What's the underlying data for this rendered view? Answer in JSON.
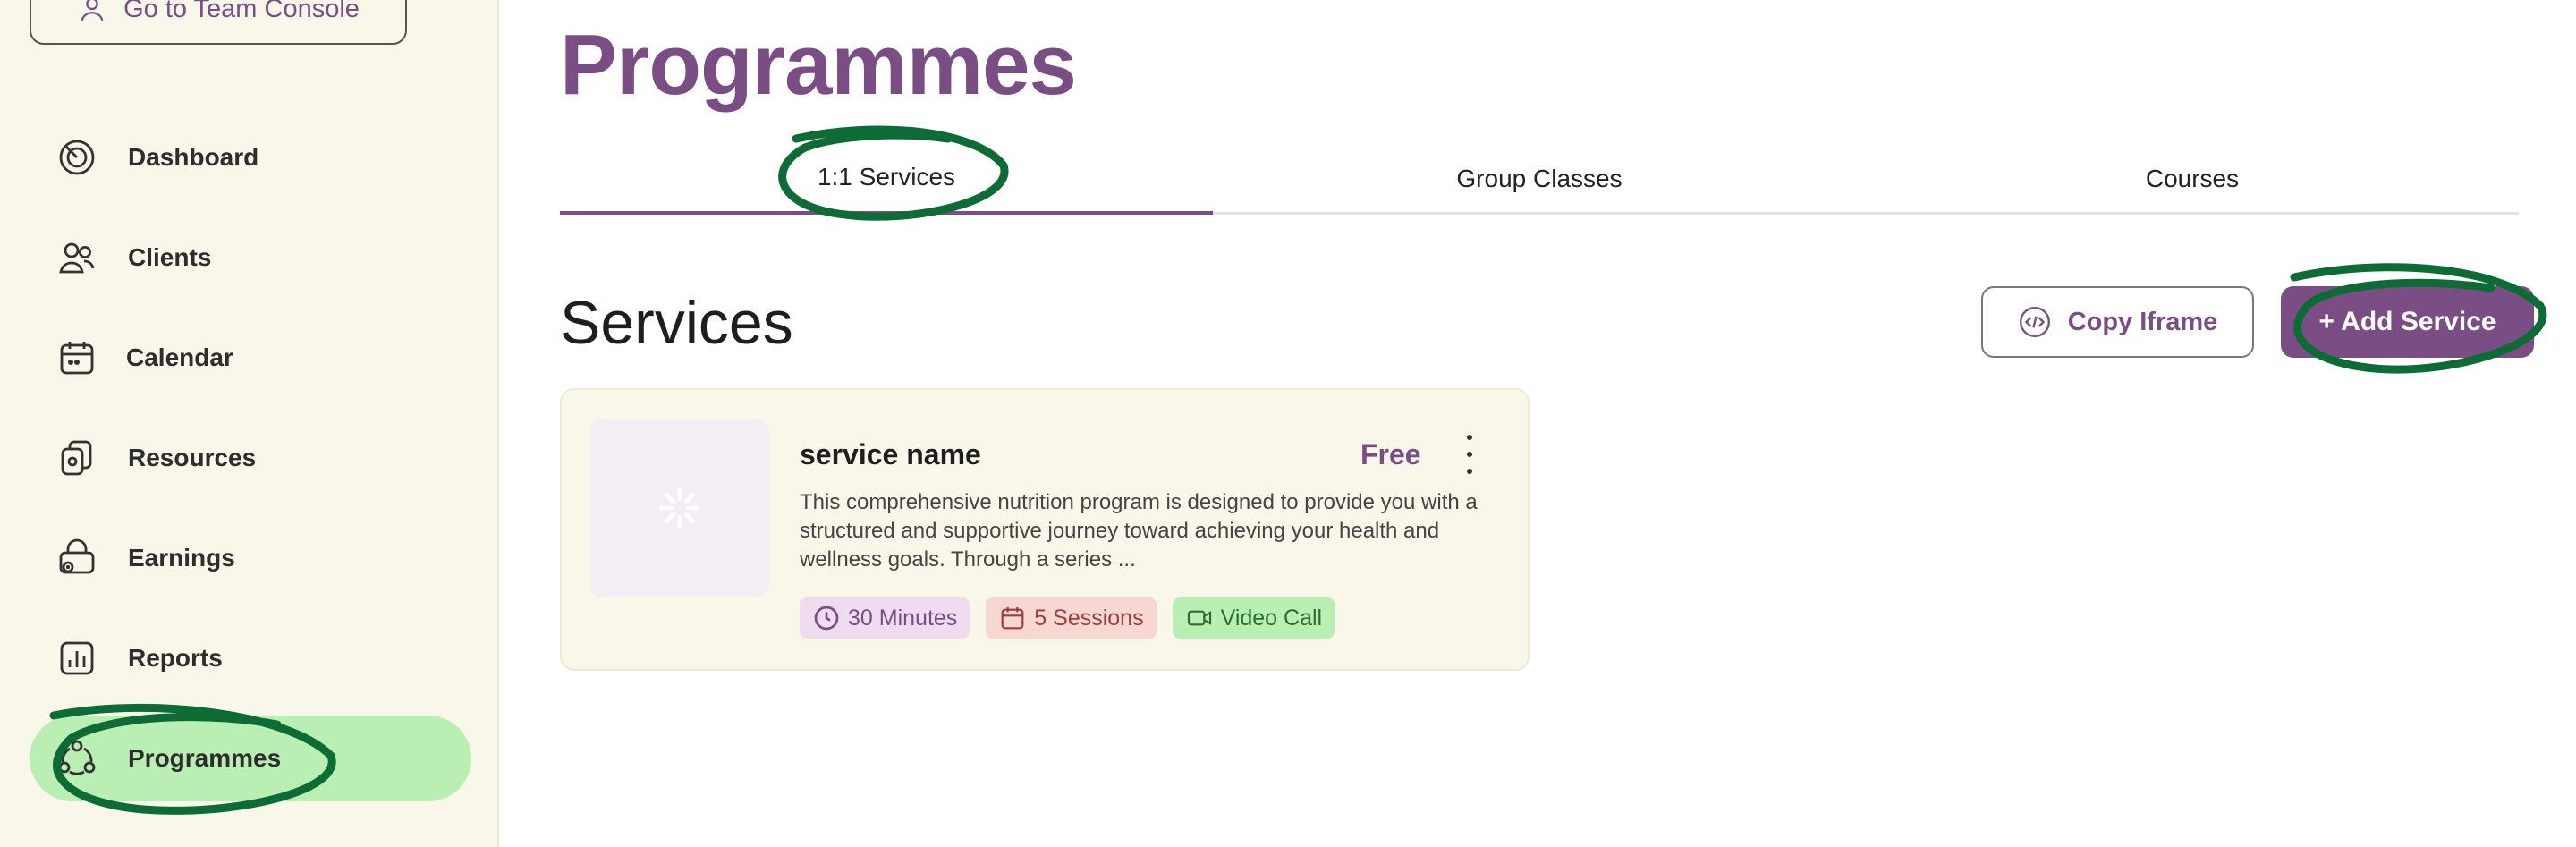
{
  "sidebar": {
    "team_console_label": "Go to Team Console",
    "items": [
      {
        "label": "Dashboard",
        "icon": "dashboard-icon"
      },
      {
        "label": "Clients",
        "icon": "clients-icon"
      },
      {
        "label": "Calendar",
        "icon": "calendar-icon"
      },
      {
        "label": "Resources",
        "icon": "resources-icon"
      },
      {
        "label": "Earnings",
        "icon": "earnings-icon"
      },
      {
        "label": "Reports",
        "icon": "reports-icon"
      },
      {
        "label": "Programmes",
        "icon": "programmes-icon",
        "active": true
      }
    ]
  },
  "main": {
    "title": "Programmes",
    "tabs": [
      {
        "label": "1:1 Services",
        "active": true
      },
      {
        "label": "Group Classes"
      },
      {
        "label": "Courses"
      }
    ],
    "section_title": "Services",
    "copy_iframe_label": "Copy Iframe",
    "add_service_label": "+ Add Service",
    "service_card": {
      "name": "service name",
      "price": "Free",
      "description": "This comprehensive nutrition program is designed to provide you with a structured and supportive journey toward achieving your health and wellness goals. Through a series ...",
      "tags": {
        "duration": "30 Minutes",
        "sessions": "5 Sessions",
        "mode": "Video Call"
      }
    }
  },
  "colors": {
    "brand": "#7a4e84",
    "sidebar_bg": "#f8f7ea",
    "active_bg": "#b9efb2",
    "annotation": "#0d6b35"
  }
}
